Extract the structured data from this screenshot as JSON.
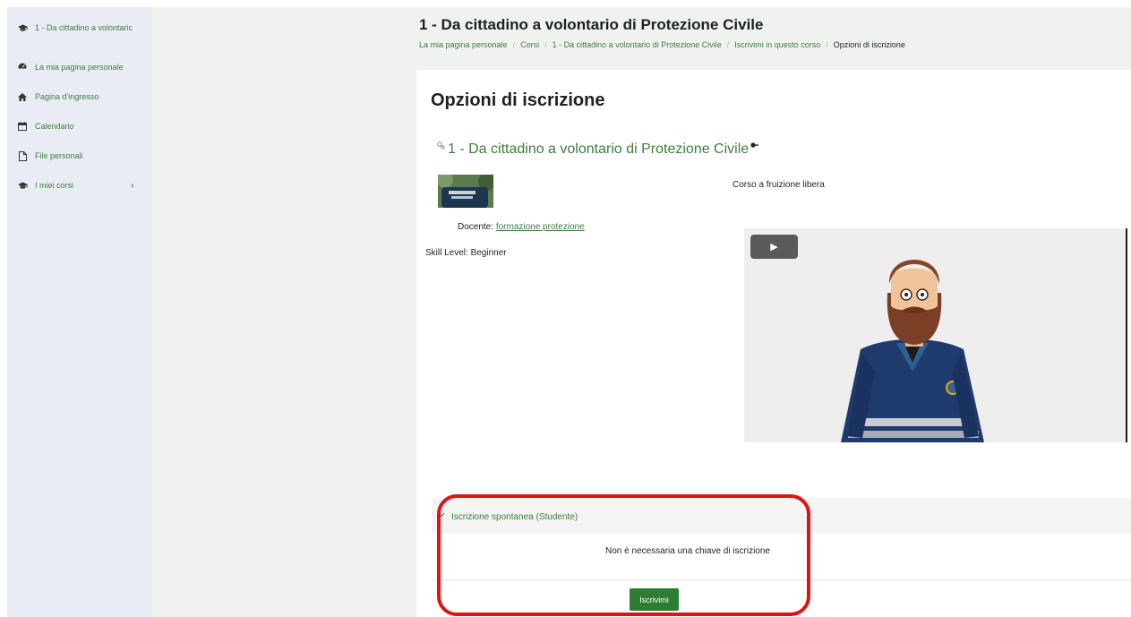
{
  "sidebar": {
    "items": [
      {
        "label": "1 - Da cittadino a volontaric",
        "icon": "graduation-cap-icon"
      },
      {
        "label": "La mia pagina personale",
        "icon": "dashboard-icon"
      },
      {
        "label": "Pagina d'ingresso",
        "icon": "home-icon"
      },
      {
        "label": "Calendario",
        "icon": "calendar-icon"
      },
      {
        "label": "File personali",
        "icon": "file-icon"
      },
      {
        "label": "I miei corsi",
        "icon": "graduation-cap-icon"
      }
    ],
    "chevron": "›"
  },
  "header": {
    "title": "1 - Da cittadino a volontario di Protezione Civile",
    "breadcrumb": [
      "La mia pagina personale",
      "Corsi",
      "1 - Da cittadino a volontario di Protezione Civile",
      "Iscrivimi in questo corso",
      "Opzioni di iscrizione"
    ],
    "separator": "/"
  },
  "main": {
    "page_title": "Opzioni di iscrizione",
    "course": {
      "name": "1 - Da cittadino a volontario di Protezione Civile",
      "summary": "Corso a fruizione libera",
      "teacher_label": "Docente:",
      "teacher_name": "formazione protezione",
      "skill_level": "Skill Level: Beginner"
    },
    "video": {
      "play_symbol": "▶"
    },
    "enrolment": {
      "method": "Iscrizione spontanea (Studente)",
      "note": "Non è necessaria una chiave di iscrizione",
      "button_label": "Iscrivimi"
    }
  },
  "colors": {
    "accent": "#3d7d3d",
    "button": "#2e7d32",
    "annotation": "#e01313",
    "sidebar_bg": "#e9ecf4"
  }
}
